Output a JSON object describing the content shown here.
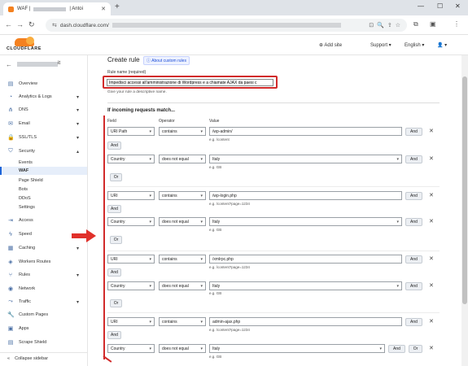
{
  "browser": {
    "tab_title": "WAF |",
    "tab_suffix": "| Antoi",
    "url": "dash.cloudflare.com/"
  },
  "cf": {
    "logo_text": "CLOUDFLARE",
    "add_site": "Add site",
    "support": "Support",
    "language": "English"
  },
  "sidebar": {
    "account_suffix": "it",
    "items": [
      {
        "label": "Overview",
        "icon": "document-icon"
      },
      {
        "label": "Analytics & Logs",
        "icon": "chart-icon"
      },
      {
        "label": "DNS",
        "icon": "dns-icon"
      },
      {
        "label": "Email",
        "icon": "email-icon"
      },
      {
        "label": "SSL/TLS",
        "icon": "lock-icon"
      },
      {
        "label": "Security",
        "icon": "shield-icon"
      }
    ],
    "security_sub": [
      "Events",
      "WAF",
      "Page Shield",
      "Bots",
      "DDoS",
      "Settings"
    ],
    "items2": [
      {
        "label": "Access",
        "icon": "access-icon"
      },
      {
        "label": "Speed",
        "icon": "bolt-icon"
      },
      {
        "label": "Caching",
        "icon": "caching-icon"
      },
      {
        "label": "Workers Routes",
        "icon": "workers-icon"
      },
      {
        "label": "Rules",
        "icon": "rules-icon"
      },
      {
        "label": "Network",
        "icon": "network-icon"
      },
      {
        "label": "Traffic",
        "icon": "traffic-icon"
      },
      {
        "label": "Custom Pages",
        "icon": "wrench-icon"
      },
      {
        "label": "Apps",
        "icon": "apps-icon"
      },
      {
        "label": "Scrape Shield",
        "icon": "scrape-icon"
      }
    ],
    "collapse": "Collapse sidebar"
  },
  "main": {
    "title": "Create rule",
    "about": "About custom rules",
    "rule_name_label": "Rule name (required)",
    "rule_name_value": "Impedisci accessi all'amministrazione di Wordpress e a chiamate AJAX da paesi c",
    "rule_name_help": "Give your rule a descriptive name.",
    "if_match": "If incoming requests match...",
    "col_field": "Field",
    "col_operator": "Operator",
    "col_value": "Value",
    "and": "And",
    "or": "Or",
    "rows": [
      {
        "field": "URI Path",
        "op": "contains",
        "value": "/wp-admin/",
        "eg": "e.g. /content"
      },
      {
        "field": "Country",
        "op": "does not equal",
        "value": "Italy",
        "eg": "e.g. GB"
      },
      {
        "field": "URI",
        "op": "contains",
        "value": "/wp-login.php",
        "eg": "e.g. /content?page=1234"
      },
      {
        "field": "Country",
        "op": "does not equal",
        "value": "Italy",
        "eg": "e.g. GB"
      },
      {
        "field": "URI",
        "op": "contains",
        "value": "/xmlrpc.php",
        "eg": "e.g. /content?page=1234"
      },
      {
        "field": "Country",
        "op": "does not equal",
        "value": "Italy",
        "eg": "e.g. GB"
      },
      {
        "field": "URI",
        "op": "contains",
        "value": "admin-ajax.php",
        "eg": "e.g. /content?page=1234"
      },
      {
        "field": "Country",
        "op": "does not equal",
        "value": "Italy",
        "eg": "e.g. GB"
      }
    ]
  }
}
